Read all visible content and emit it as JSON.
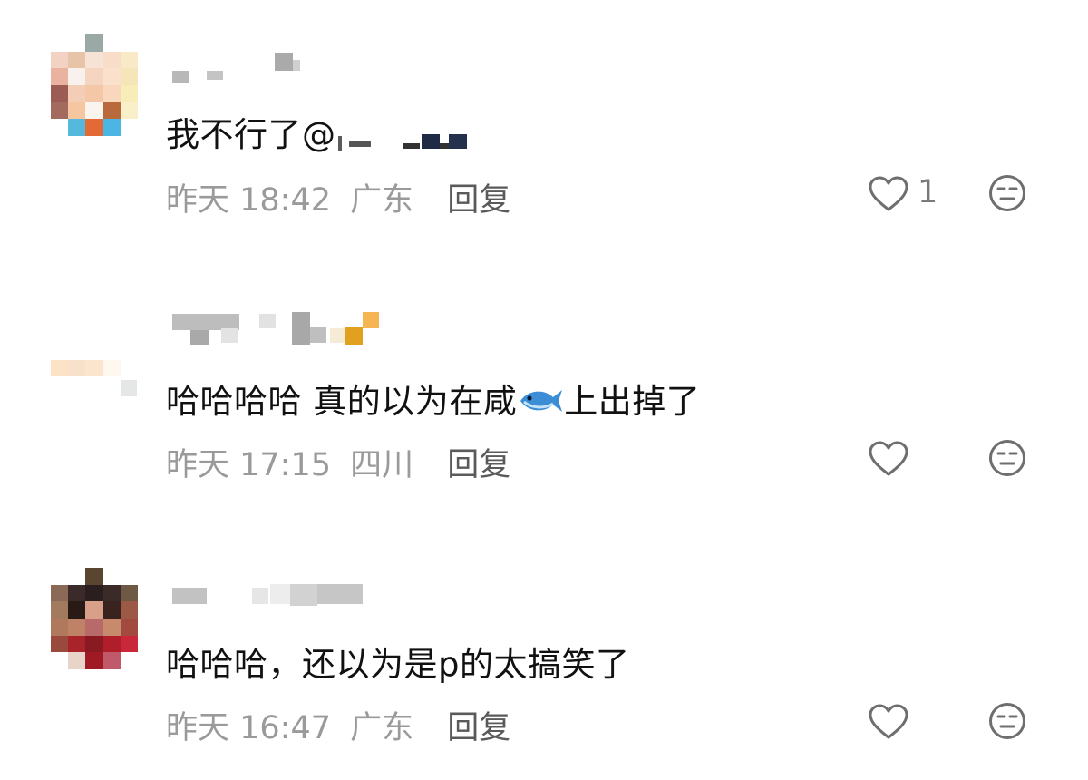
{
  "comments": [
    {
      "text": "我不行了@",
      "time": "昨天 18:42",
      "location": "广东",
      "reply_label": "回复",
      "likes": "1"
    },
    {
      "text_before_emoji": "哈哈哈哈 真的以为在咸",
      "emoji": "🐟",
      "text_after_emoji": "上出掉了",
      "time": "昨天 17:15",
      "location": "四川",
      "reply_label": "回复",
      "likes": ""
    },
    {
      "text": "哈哈哈，还以为是p的太搞笑了",
      "time": "昨天 16:47",
      "location": "广东",
      "reply_label": "回复",
      "likes": ""
    }
  ],
  "icons": {
    "like": "heart-outline-icon",
    "reaction": "expressionless-face-icon",
    "fish": "fish-emoji"
  },
  "colors": {
    "text": "#111111",
    "meta": "#9a9a9a",
    "reply": "#5a5a5a",
    "icon": "#7a7a7a"
  }
}
